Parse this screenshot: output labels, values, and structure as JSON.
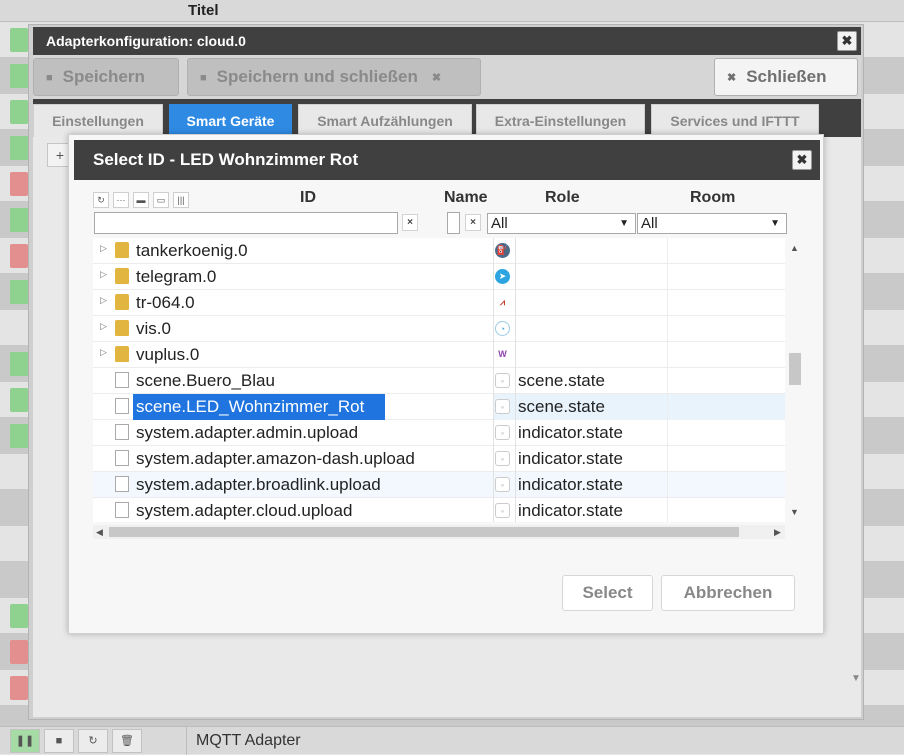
{
  "background": {
    "column_title": "Titel",
    "footer_adapter_name": "MQTT Adapter",
    "footer_buttons": [
      "play-icon",
      "stop-icon",
      "reload-icon",
      "delete-icon"
    ]
  },
  "config_window": {
    "title": "Adapterkonfiguration: cloud.0",
    "toolbar": {
      "save_label": "Speichern",
      "save_close_label": "Speichern und schließen",
      "close_label": "Schließen"
    },
    "tabs": [
      {
        "label": "Einstellungen"
      },
      {
        "label": "Smart Geräte"
      },
      {
        "label": "Smart Aufzählungen"
      },
      {
        "label": "Extra-Einstellungen"
      },
      {
        "label": "Services und IFTTT"
      }
    ],
    "active_tab": "Smart Geräte",
    "plus_label": "+"
  },
  "dialog": {
    "title": "Select ID - LED Wohnzimmer Rot",
    "columns": {
      "id": "ID",
      "name": "Name",
      "role": "Role",
      "room": "Room"
    },
    "filters": {
      "role_value": "All",
      "room_value": "All",
      "clear_symbol": "×"
    },
    "rows": [
      {
        "id": "tankerkoenig.0",
        "type": "folder",
        "role": "",
        "icon": "tankerkoenig-icon"
      },
      {
        "id": "telegram.0",
        "type": "folder",
        "role": "",
        "icon": "telegram-icon"
      },
      {
        "id": "tr-064.0",
        "type": "folder",
        "role": "",
        "icon": "tr064-icon"
      },
      {
        "id": "vis.0",
        "type": "folder",
        "role": "",
        "icon": "vis-icon"
      },
      {
        "id": "vuplus.0",
        "type": "folder",
        "role": "",
        "icon": "vuplus-icon"
      },
      {
        "id": "scene.Buero_Blau",
        "type": "state",
        "role": "scene.state",
        "icon": "state-icon"
      },
      {
        "id": "scene.LED_Wohnzimmer_Rot",
        "type": "state",
        "role": "scene.state",
        "icon": "state-icon",
        "selected": true
      },
      {
        "id": "system.adapter.admin.upload",
        "type": "state",
        "role": "indicator.state",
        "icon": "state-icon"
      },
      {
        "id": "system.adapter.amazon-dash.upload",
        "type": "state",
        "role": "indicator.state",
        "icon": "state-icon"
      },
      {
        "id": "system.adapter.broadlink.upload",
        "type": "state",
        "role": "indicator.state",
        "icon": "state-icon"
      },
      {
        "id": "system.adapter.cloud.upload",
        "type": "state",
        "role": "indicator.state",
        "icon": "state-icon"
      }
    ],
    "buttons": {
      "select": "Select",
      "cancel": "Abbrechen"
    }
  },
  "colors": {
    "title_bar": "#404040",
    "active_tab": "#2f8ae3",
    "selection": "#1f74e0"
  }
}
